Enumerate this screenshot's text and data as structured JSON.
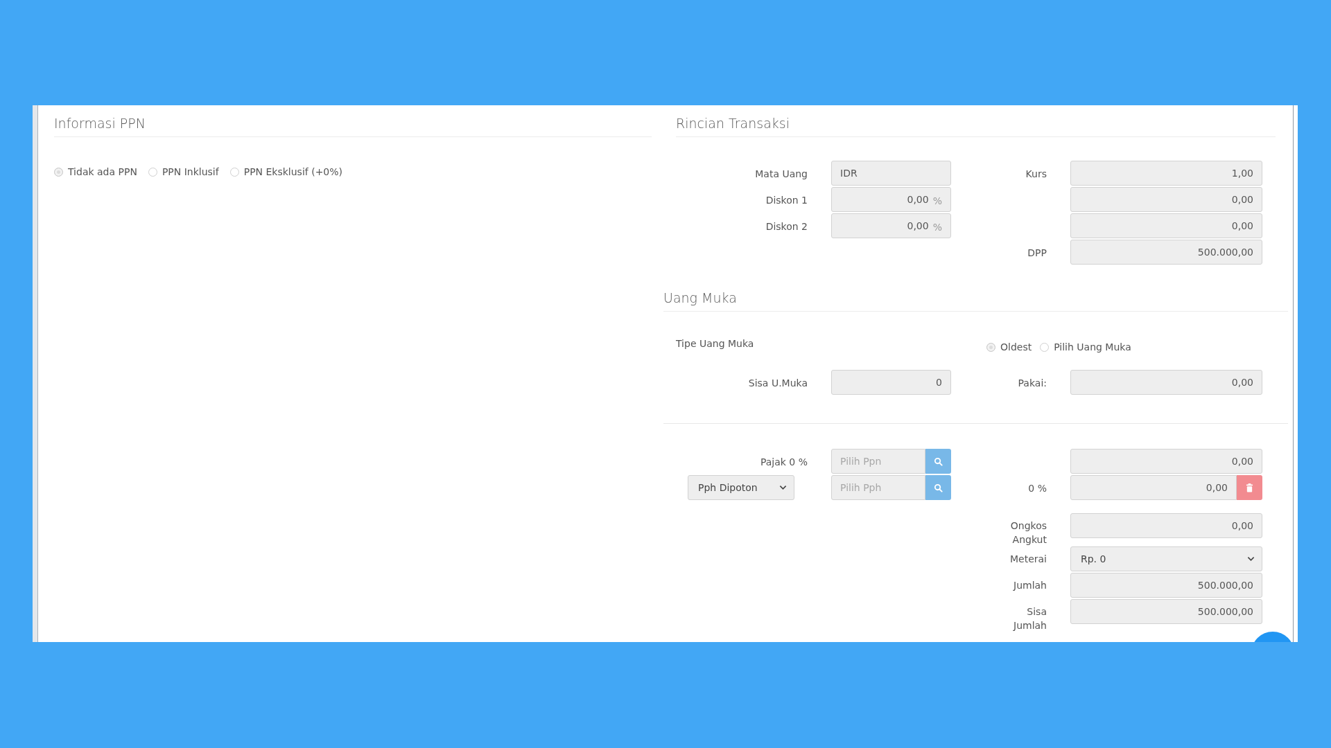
{
  "informasi_ppn": {
    "title": "Informasi PPN",
    "options": [
      {
        "label": "Tidak ada PPN",
        "selected": true
      },
      {
        "label": "PPN Inklusif",
        "selected": false
      },
      {
        "label": "PPN Eksklusif (+0%)",
        "selected": false
      }
    ]
  },
  "rincian_transaksi": {
    "title": "Rincian Transaksi",
    "rows": [
      {
        "label": {
          "kind": "label",
          "text": "Mata Uang"
        },
        "field": {
          "kind": "text",
          "value": "IDR"
        },
        "label_2": {
          "kind": "label",
          "text": "Kurs"
        },
        "field_2": {
          "kind": "number",
          "value": "1,00"
        }
      },
      {
        "label": {
          "kind": "label",
          "text": "Diskon 1"
        },
        "field": {
          "kind": "percent",
          "value": "0,00",
          "suffix": "%"
        },
        "field_2": {
          "kind": "number",
          "value": "0,00"
        }
      },
      {
        "label": {
          "kind": "label",
          "text": "Diskon 2"
        },
        "field": {
          "kind": "percent",
          "value": "0,00",
          "suffix": "%"
        },
        "field_2": {
          "kind": "number",
          "value": "0,00"
        }
      },
      {
        "label_2": {
          "kind": "label",
          "text": "DPP"
        },
        "field_2": {
          "kind": "number",
          "value": "500.000,00"
        }
      }
    ]
  },
  "uang_muka": {
    "title": "Uang Muka",
    "type_label": "Tipe Uang Muka",
    "options": [
      {
        "label": "Oldest",
        "selected": true
      },
      {
        "label": "Pilih Uang Muka",
        "selected": false
      }
    ],
    "rows": [
      {
        "label": {
          "kind": "label",
          "text": "Sisa U.Muka"
        },
        "field": {
          "kind": "number",
          "value": "0"
        },
        "label_2": {
          "kind": "label",
          "text": "Pakai:"
        },
        "field_2": {
          "kind": "number",
          "value": "0,00"
        }
      }
    ]
  },
  "tax_rows": [
    {
      "label": {
        "kind": "label",
        "text": "Pajak 0 %"
      },
      "field": {
        "kind": "search",
        "placeholder": "Pilih Ppn"
      },
      "field_2": {
        "kind": "number",
        "value": "0,00"
      }
    },
    {
      "label": {
        "kind": "select",
        "value": "Pph Dipoton"
      },
      "field": {
        "kind": "search",
        "placeholder": "Pilih Pph"
      },
      "label_2": {
        "kind": "label",
        "text": "0 %"
      },
      "field_2": {
        "kind": "number-delete",
        "value": "0,00"
      }
    }
  ],
  "total_rows": [
    {
      "label_2": {
        "kind": "label",
        "text": "Ongkos Angkut"
      },
      "field_2": {
        "kind": "number",
        "value": "0,00"
      }
    },
    {
      "label_2": {
        "kind": "label",
        "text": "Meterai"
      },
      "field_2": {
        "kind": "select",
        "value": "Rp. 0"
      }
    },
    {
      "label_2": {
        "kind": "label",
        "text": "Jumlah"
      },
      "field_2": {
        "kind": "number",
        "value": "500.000,00"
      }
    },
    {
      "label_2": {
        "kind": "label",
        "text": "Sisa Jumlah"
      },
      "field_2": {
        "kind": "number",
        "value": "500.000,00"
      }
    }
  ]
}
